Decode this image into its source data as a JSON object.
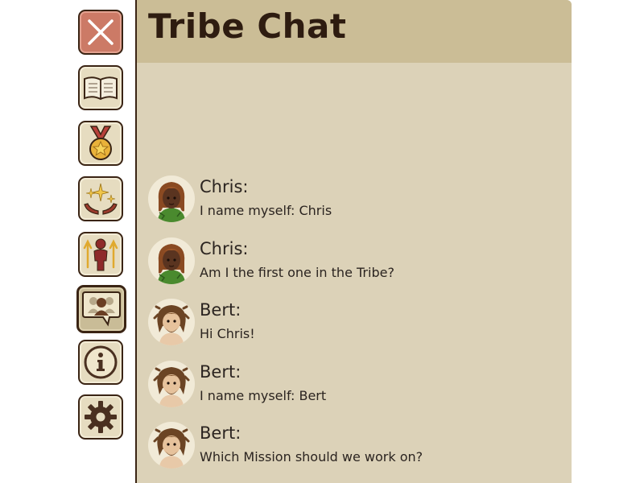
{
  "chat": {
    "title": "Tribe Chat",
    "messages": [
      {
        "name": "Chris:",
        "text": "I name myself: Chris",
        "avatar": "chris-avatar"
      },
      {
        "name": "Chris:",
        "text": "Am I the first one in the Tribe?",
        "avatar": "chris-avatar"
      },
      {
        "name": "Bert:",
        "text": "Hi Chris!",
        "avatar": "bert-avatar"
      },
      {
        "name": "Bert:",
        "text": "I name myself: Bert",
        "avatar": "bert-avatar"
      },
      {
        "name": "Bert:",
        "text": "Which Mission should we work on?",
        "avatar": "bert-avatar"
      }
    ]
  },
  "sidebar": {
    "buttons": [
      {
        "icon": "close-icon"
      },
      {
        "icon": "book-icon"
      },
      {
        "icon": "medal-icon"
      },
      {
        "icon": "blessing-hands-icon"
      },
      {
        "icon": "person-growth-icon"
      },
      {
        "icon": "tribe-chat-icon",
        "active": true
      },
      {
        "icon": "info-icon"
      },
      {
        "icon": "gear-icon"
      }
    ]
  },
  "colors": {
    "panel": "#dcd2b8",
    "header": "#cbbd96",
    "title": "#2e1c10",
    "close_button": "#cc7a66",
    "border": "#3a2414"
  }
}
